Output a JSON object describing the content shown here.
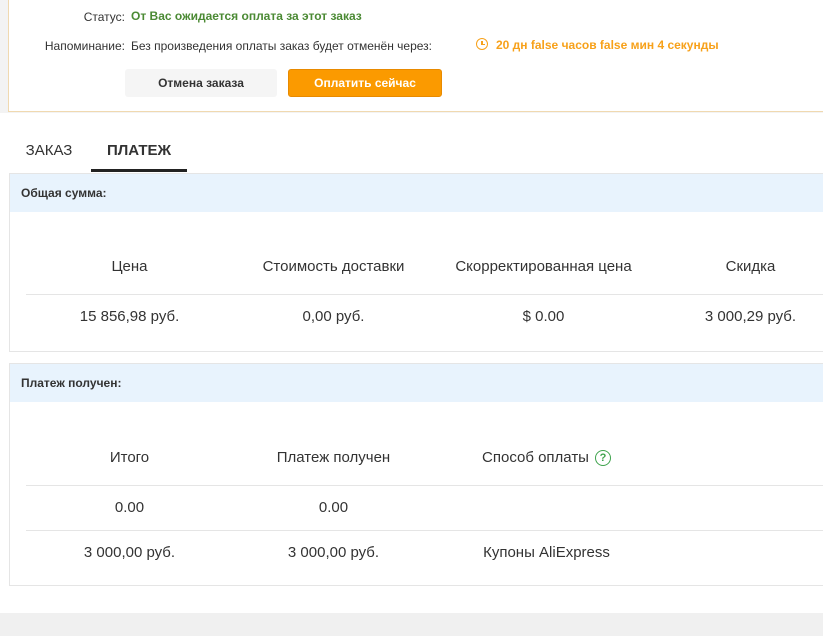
{
  "status_panel": {
    "status_label": "Статус:",
    "status_value": "От Вас ожидается оплата за этот заказ",
    "reminder_label": "Напоминание:",
    "reminder_text": "Без произведения оплаты заказ будет отменён через:",
    "countdown_icon": "clock-icon",
    "countdown": "20 дн false часов false мин 4 секунды",
    "cancel_button": "Отмена заказа",
    "pay_button": "Оплатить сейчас"
  },
  "tabs": [
    {
      "label": "ЗАКАЗ",
      "active": false
    },
    {
      "label": "ПЛАТЕЖ",
      "active": true
    }
  ],
  "total_section": {
    "title": "Общая сумма:",
    "headers": [
      "Цена",
      "Стоимость доставки",
      "Скорректированная цена",
      "Скидка"
    ],
    "values": [
      "15 856,98 руб.",
      "0,00 руб.",
      "$ 0.00",
      "3 000,29 руб."
    ]
  },
  "payment_section": {
    "title": "Платеж получен:",
    "headers": [
      "Итого",
      "Платеж получен",
      "Способ оплаты"
    ],
    "help_icon": "question-circle-icon",
    "rows": [
      [
        "0.00",
        "0.00",
        ""
      ],
      [
        "3 000,00 руб.",
        "3 000,00 руб.",
        "Купоны AliExpress"
      ]
    ]
  },
  "colors": {
    "status_green": "#4b8a34",
    "countdown_orange": "#f7a11a",
    "pay_button": "#fb9a00",
    "section_header_bg": "#e8f3fd"
  }
}
